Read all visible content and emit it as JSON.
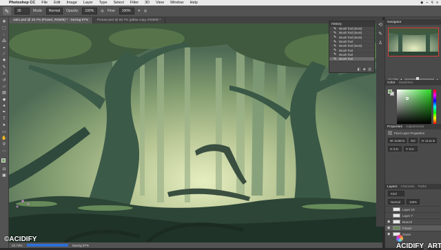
{
  "menubar": {
    "apple": "",
    "items": [
      "Photoshop CC",
      "File",
      "Edit",
      "Image",
      "Layer",
      "Type",
      "Select",
      "Filter",
      "3D",
      "View",
      "Window",
      "Help"
    ],
    "right": [
      "◉",
      "⌁",
      "⚲",
      "≡"
    ]
  },
  "options": {
    "mode_label": "Mode:",
    "mode_value": "Normal",
    "opacity_label": "Opacity:",
    "opacity_value": "100%",
    "flow_label": "Flow:",
    "flow_value": "100%",
    "brush_size": "35"
  },
  "tabs": [
    {
      "label": "Jak1.psd @ 23.7% (Flower, RGB/8) * · Sezing 97%",
      "active": true
    },
    {
      "label": "Picture.psd @ 66.7% (pikita copy, RGB/8) *",
      "active": false
    }
  ],
  "status": {
    "zoom": "23.73%",
    "info": "Saving 97%"
  },
  "history": {
    "title": "History",
    "items": [
      "Brush Tool (Semi)",
      "Brush Tool (Semi)",
      "Brush Tool (Semi)",
      "Brush Tool",
      "Brush Tool (Semi)",
      "Brush Tool",
      "Brush Tool",
      "Brush Tool"
    ],
    "selected_index": 7
  },
  "navigator": {
    "title": "Navigator",
    "zoom": "23.73%"
  },
  "color": {
    "tabs": [
      "Color",
      "Swatches"
    ],
    "fg": "#7aa86a",
    "bg": "#d6d6d6",
    "hue_accent": "#2bdc24"
  },
  "properties": {
    "tabs": [
      "Properties",
      "Adjustments"
    ],
    "section": "Pixel Layer Properties",
    "w": "W: 14.58 in",
    "h": "H: 11.11 in",
    "go": "GO",
    "x": "X: 0 in",
    "y": "Y: 0 in"
  },
  "layers": {
    "tabs": [
      "Layers",
      "Channels",
      "Paths"
    ],
    "kind": "Kind",
    "blend": "Normal",
    "opacity": "100%",
    "fill": "100%",
    "rows": [
      {
        "name": "Layer 10",
        "thumb": "white",
        "eye": "",
        "selected": false
      },
      {
        "name": "Layer 7",
        "thumb": "white",
        "eye": "",
        "selected": false
      },
      {
        "name": "Branch",
        "thumb": "white",
        "eye": "◉",
        "selected": false
      },
      {
        "name": "Flower",
        "thumb": "art",
        "eye": "◉",
        "selected": true
      },
      {
        "name": "Grass",
        "thumb": "white",
        "eye": "◉",
        "selected": false
      }
    ],
    "footer": [
      "fx",
      "◐",
      "▢",
      "▤",
      "🗑"
    ]
  },
  "watermarks": {
    "left": "©ACIDIFY",
    "right": "ACIDIFY_ART"
  },
  "icons": {
    "toolbox": [
      "move-icon",
      "marquee-icon",
      "lasso-icon",
      "quick-select-icon",
      "crop-icon",
      "eyedropper-icon",
      "healing-icon",
      "brush-icon",
      "clone-stamp-icon",
      "history-brush-icon",
      "eraser-icon",
      "gradient-icon",
      "blur-icon",
      "dodge-icon",
      "pen-icon",
      "type-icon",
      "path-select-icon",
      "shape-icon",
      "hand-icon",
      "zoom-icon",
      "more-icon"
    ]
  }
}
